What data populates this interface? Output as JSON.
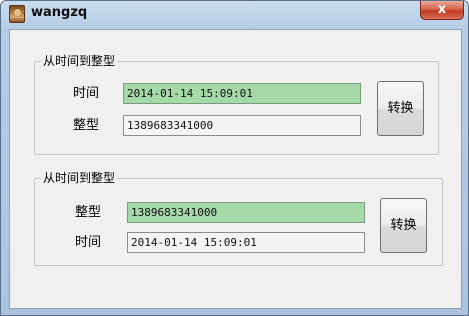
{
  "window": {
    "title": "wangzq",
    "close_label": "x"
  },
  "group1": {
    "title": "从时间到整型",
    "time_label": "时间",
    "time_value": "2014-01-14 15:09:01",
    "int_label": "整型",
    "int_value": "1389683341000",
    "convert_label": "转换"
  },
  "group2": {
    "title": "从时间到整型",
    "int_label": "整型",
    "int_value": "1389683341000",
    "time_label": "时间",
    "time_value": "2014-01-14 15:09:01",
    "convert_label": "转换"
  },
  "colors": {
    "highlight_field": "#a6d9a8",
    "close_button": "#c2391f"
  },
  "icons": {
    "app": "app-icon",
    "close": "close-icon"
  }
}
